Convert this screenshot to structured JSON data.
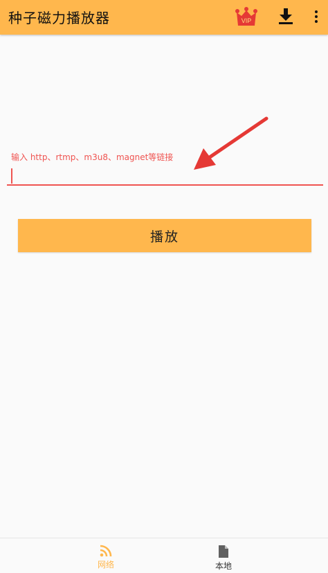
{
  "app_bar": {
    "title": "种子磁力播放器",
    "vip_label": "VIP",
    "vip_color": "#e53935",
    "icons": [
      "vip-crown-icon",
      "download-icon",
      "more-vert-icon"
    ]
  },
  "input": {
    "label": "输入 http、rtmp、m3u8、magnet等链接",
    "value": "",
    "accent_color": "#ef5350"
  },
  "play_button": {
    "label": "播放"
  },
  "bottom_nav": {
    "items": [
      {
        "label": "网络",
        "icon": "rss-feed-icon",
        "active": true
      },
      {
        "label": "本地",
        "icon": "file-icon",
        "active": false
      }
    ],
    "active_color": "#ffb74d"
  },
  "colors": {
    "primary": "#ffb74d",
    "background": "#fafafa"
  }
}
